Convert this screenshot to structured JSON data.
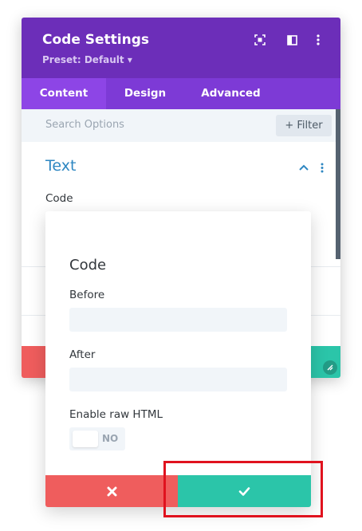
{
  "panel": {
    "title": "Code Settings",
    "preset": "Preset: Default ▾",
    "header_icons": [
      "fullscreen-icon",
      "split-view-icon",
      "more-vertical-icon"
    ],
    "tabs": [
      {
        "label": "Content",
        "active": true
      },
      {
        "label": "Design",
        "active": false
      },
      {
        "label": "Advanced",
        "active": false
      }
    ],
    "search_placeholder": "Search Options",
    "filter_label": "+ Filter",
    "section": {
      "title": "Text",
      "field_label": "Code"
    }
  },
  "popup": {
    "title": "Code",
    "fields": [
      {
        "label": "Before",
        "value": ""
      },
      {
        "label": "After",
        "value": ""
      }
    ],
    "toggle": {
      "label": "Enable raw HTML",
      "state_text": "NO",
      "on": false
    },
    "cancel_icon": "close-icon",
    "save_icon": "check-icon"
  },
  "colors": {
    "header_purple": "#6c2eb9",
    "tab_purple": "#7d3ad6",
    "active_tab": "#8d45e6",
    "cancel_red": "#ef5d5d",
    "save_green": "#2bc5a9",
    "link_blue": "#2e87c2",
    "highlight_red": "#e0121e"
  }
}
